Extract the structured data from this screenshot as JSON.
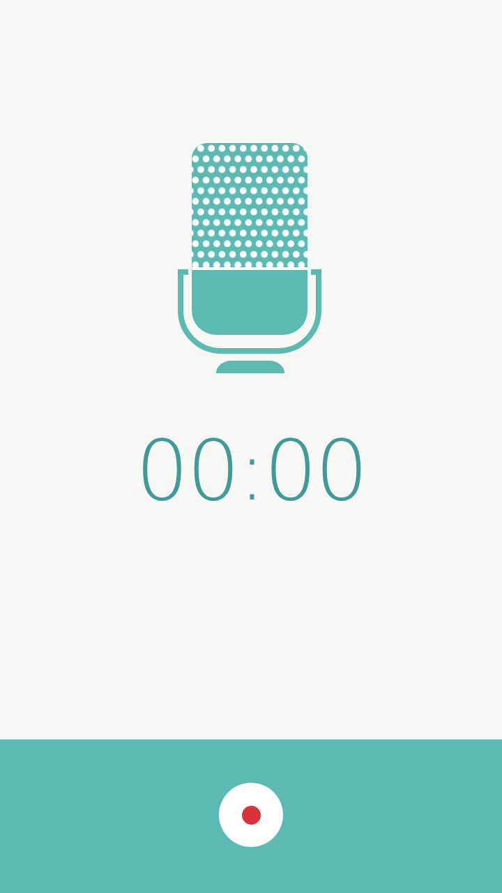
{
  "timer": {
    "text": "00:00"
  }
}
